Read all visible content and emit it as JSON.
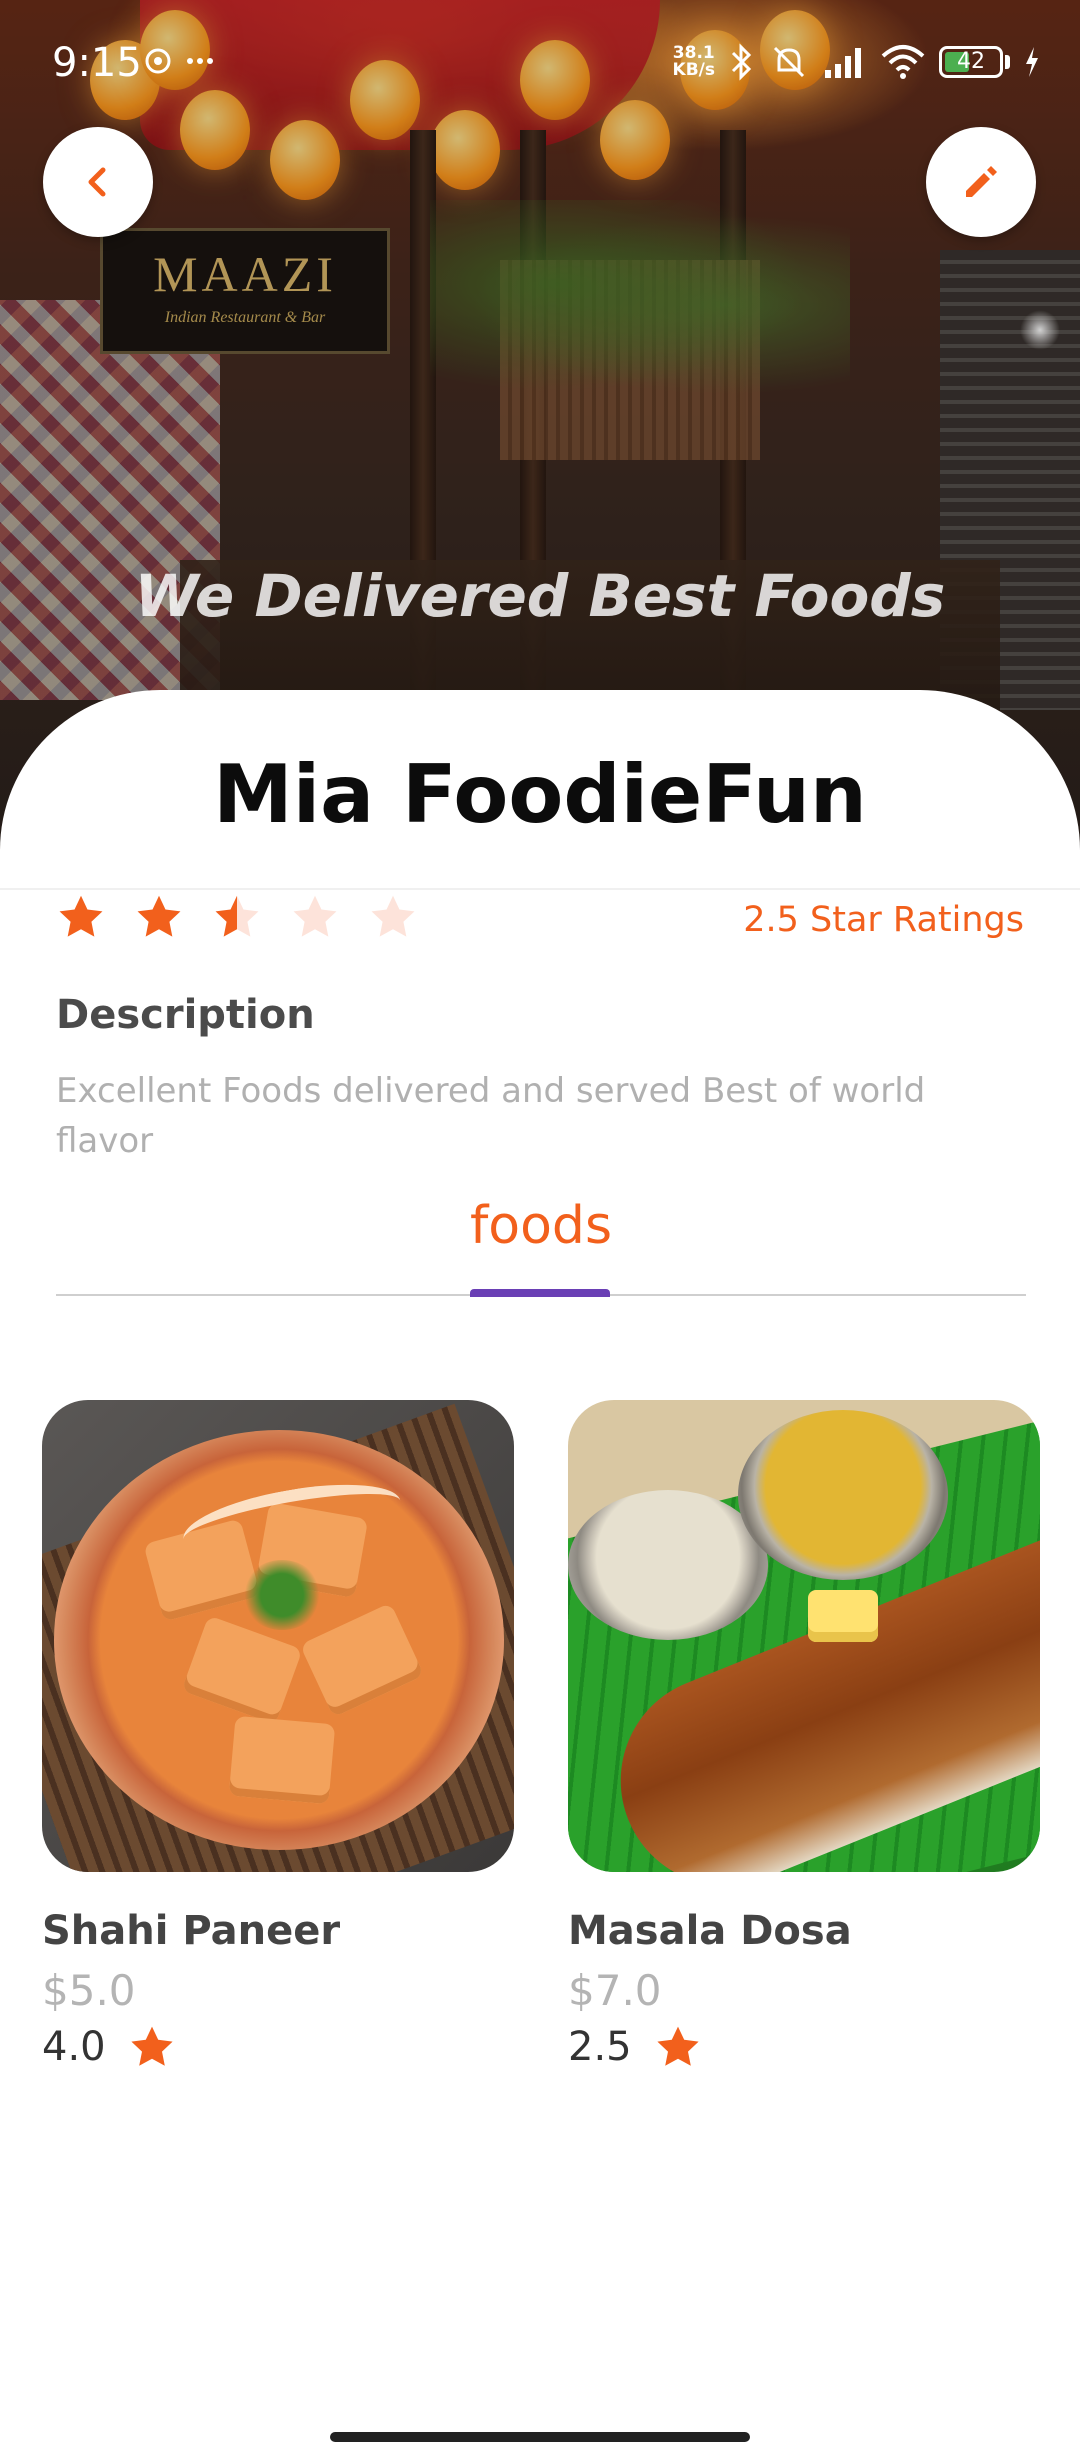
{
  "status_bar": {
    "time": "9:15",
    "net_speed_value": "38.1",
    "net_speed_unit": "KB/s",
    "battery": "42"
  },
  "hero": {
    "tagline": "We Delivered Best Foods",
    "sign_title": "MAAZI",
    "sign_subtitle": "Indian Restaurant & Bar"
  },
  "restaurant": {
    "name": "Mia FoodieFun",
    "rating": 2.5,
    "rating_label": "2.5 Star Ratings",
    "stars_max": 5
  },
  "description": {
    "heading": "Description",
    "text": "Excellent Foods delivered and served Best of world flavor"
  },
  "tabs": {
    "active": "foods"
  },
  "foods": [
    {
      "name": "Shahi Paneer",
      "price": "$5.0",
      "rating": "4.0",
      "image": "shahi-paneer-photo"
    },
    {
      "name": "Masala Dosa",
      "price": "$7.0",
      "rating": "2.5",
      "image": "masala-dosa-photo"
    }
  ],
  "colors": {
    "accent": "#f2601c",
    "star_empty": "#fde3da",
    "tab_indicator": "#6a3fb5"
  },
  "icons": {
    "back": "chevron-left-icon",
    "edit": "pencil-icon",
    "star": "star-icon"
  }
}
